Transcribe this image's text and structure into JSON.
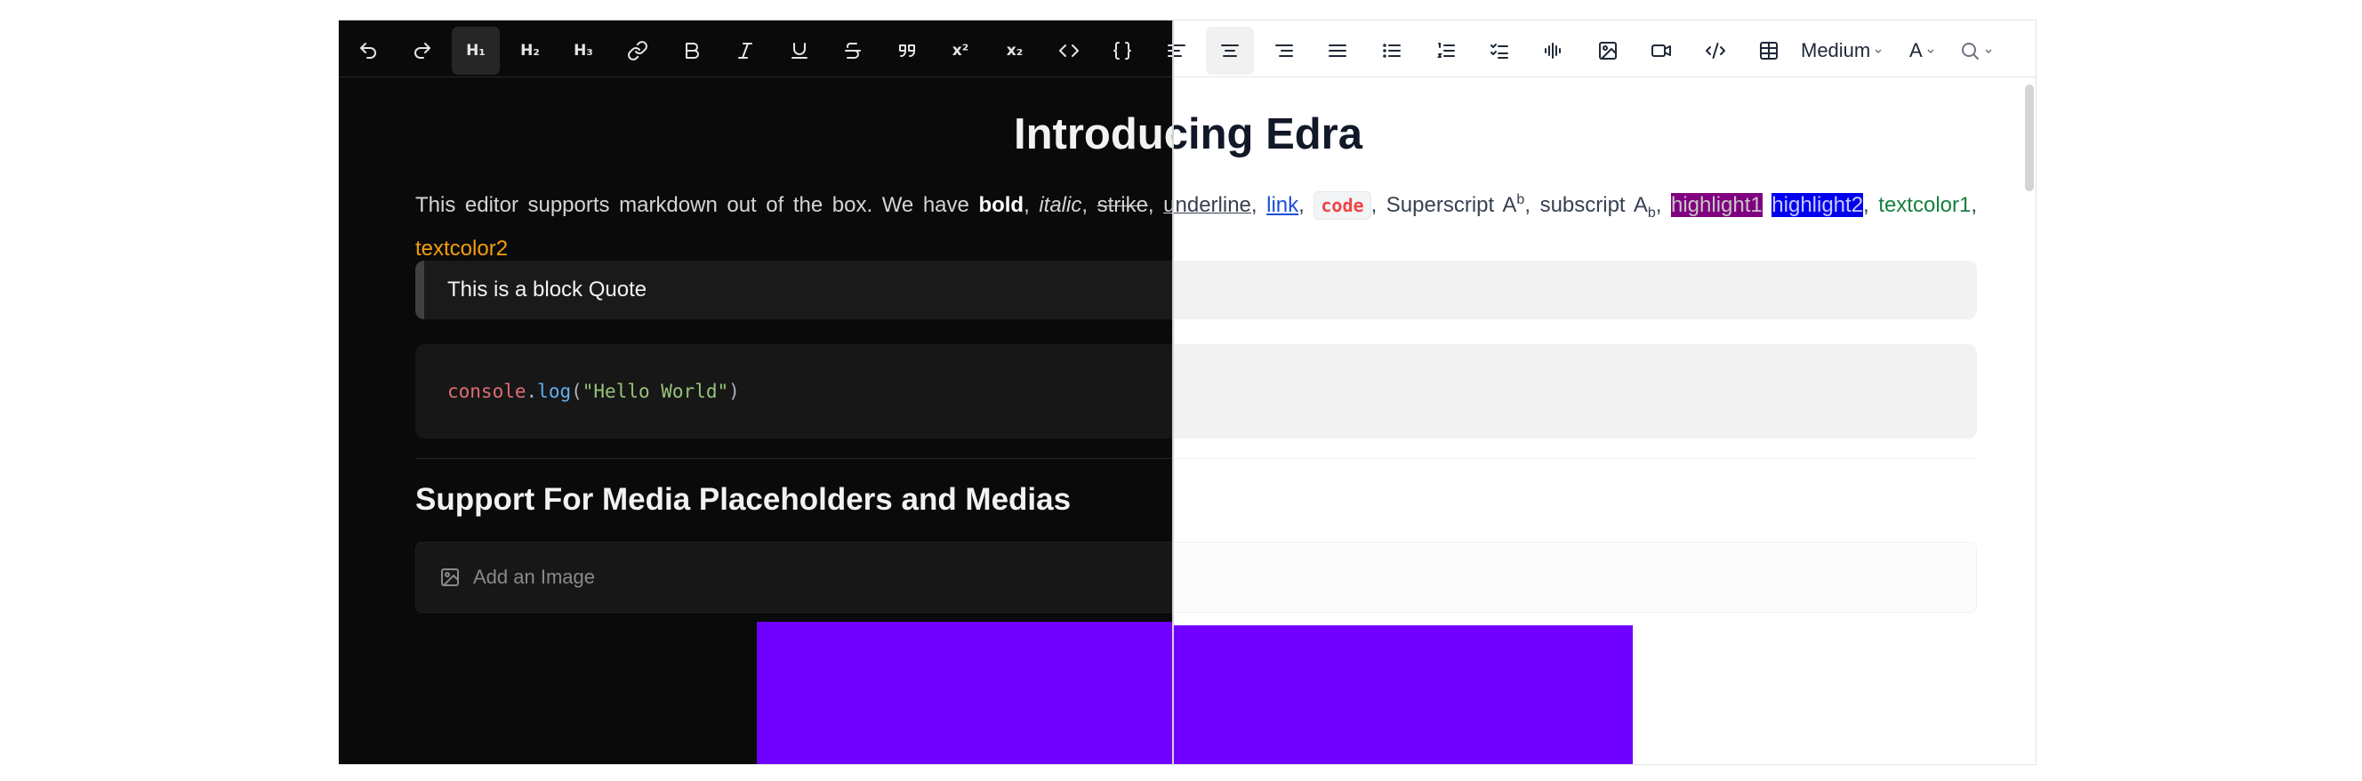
{
  "toolbar": {
    "heading1": "H₁",
    "heading2": "H₂",
    "heading3": "H₃",
    "superscript": "x²",
    "subscript": "x₂",
    "font_size": "Medium",
    "text_color": "A"
  },
  "doc": {
    "title": "Introducing Edra",
    "para_intro": "This editor supports markdown out of the box. We have ",
    "bold": "bold",
    "italic": "italic",
    "strike": "strike",
    "underline": "underline",
    "link": "link",
    "code": "code",
    "superscript_label": "Superscript A",
    "superscript_value": "b",
    "subscript_label": "subscript A",
    "subscript_value": "b",
    "highlight1": "highlight1",
    "highlight2": "highlight2",
    "textcolor1": "textcolor1",
    "textcolor2": "textcolor2",
    "quote": "This is a block Quote",
    "code_object": "console",
    "code_dot": ".",
    "code_fn": "log",
    "code_open": "(",
    "code_string": "\"Hello World\"",
    "code_close": ")",
    "heading2": "Support For Media Placeholders and Medias",
    "image_placeholder": "Add an Image"
  },
  "theme": {
    "light_bg": "#ffffff",
    "dark_bg": "#0a0a0a",
    "media_color": "#7000ff"
  }
}
